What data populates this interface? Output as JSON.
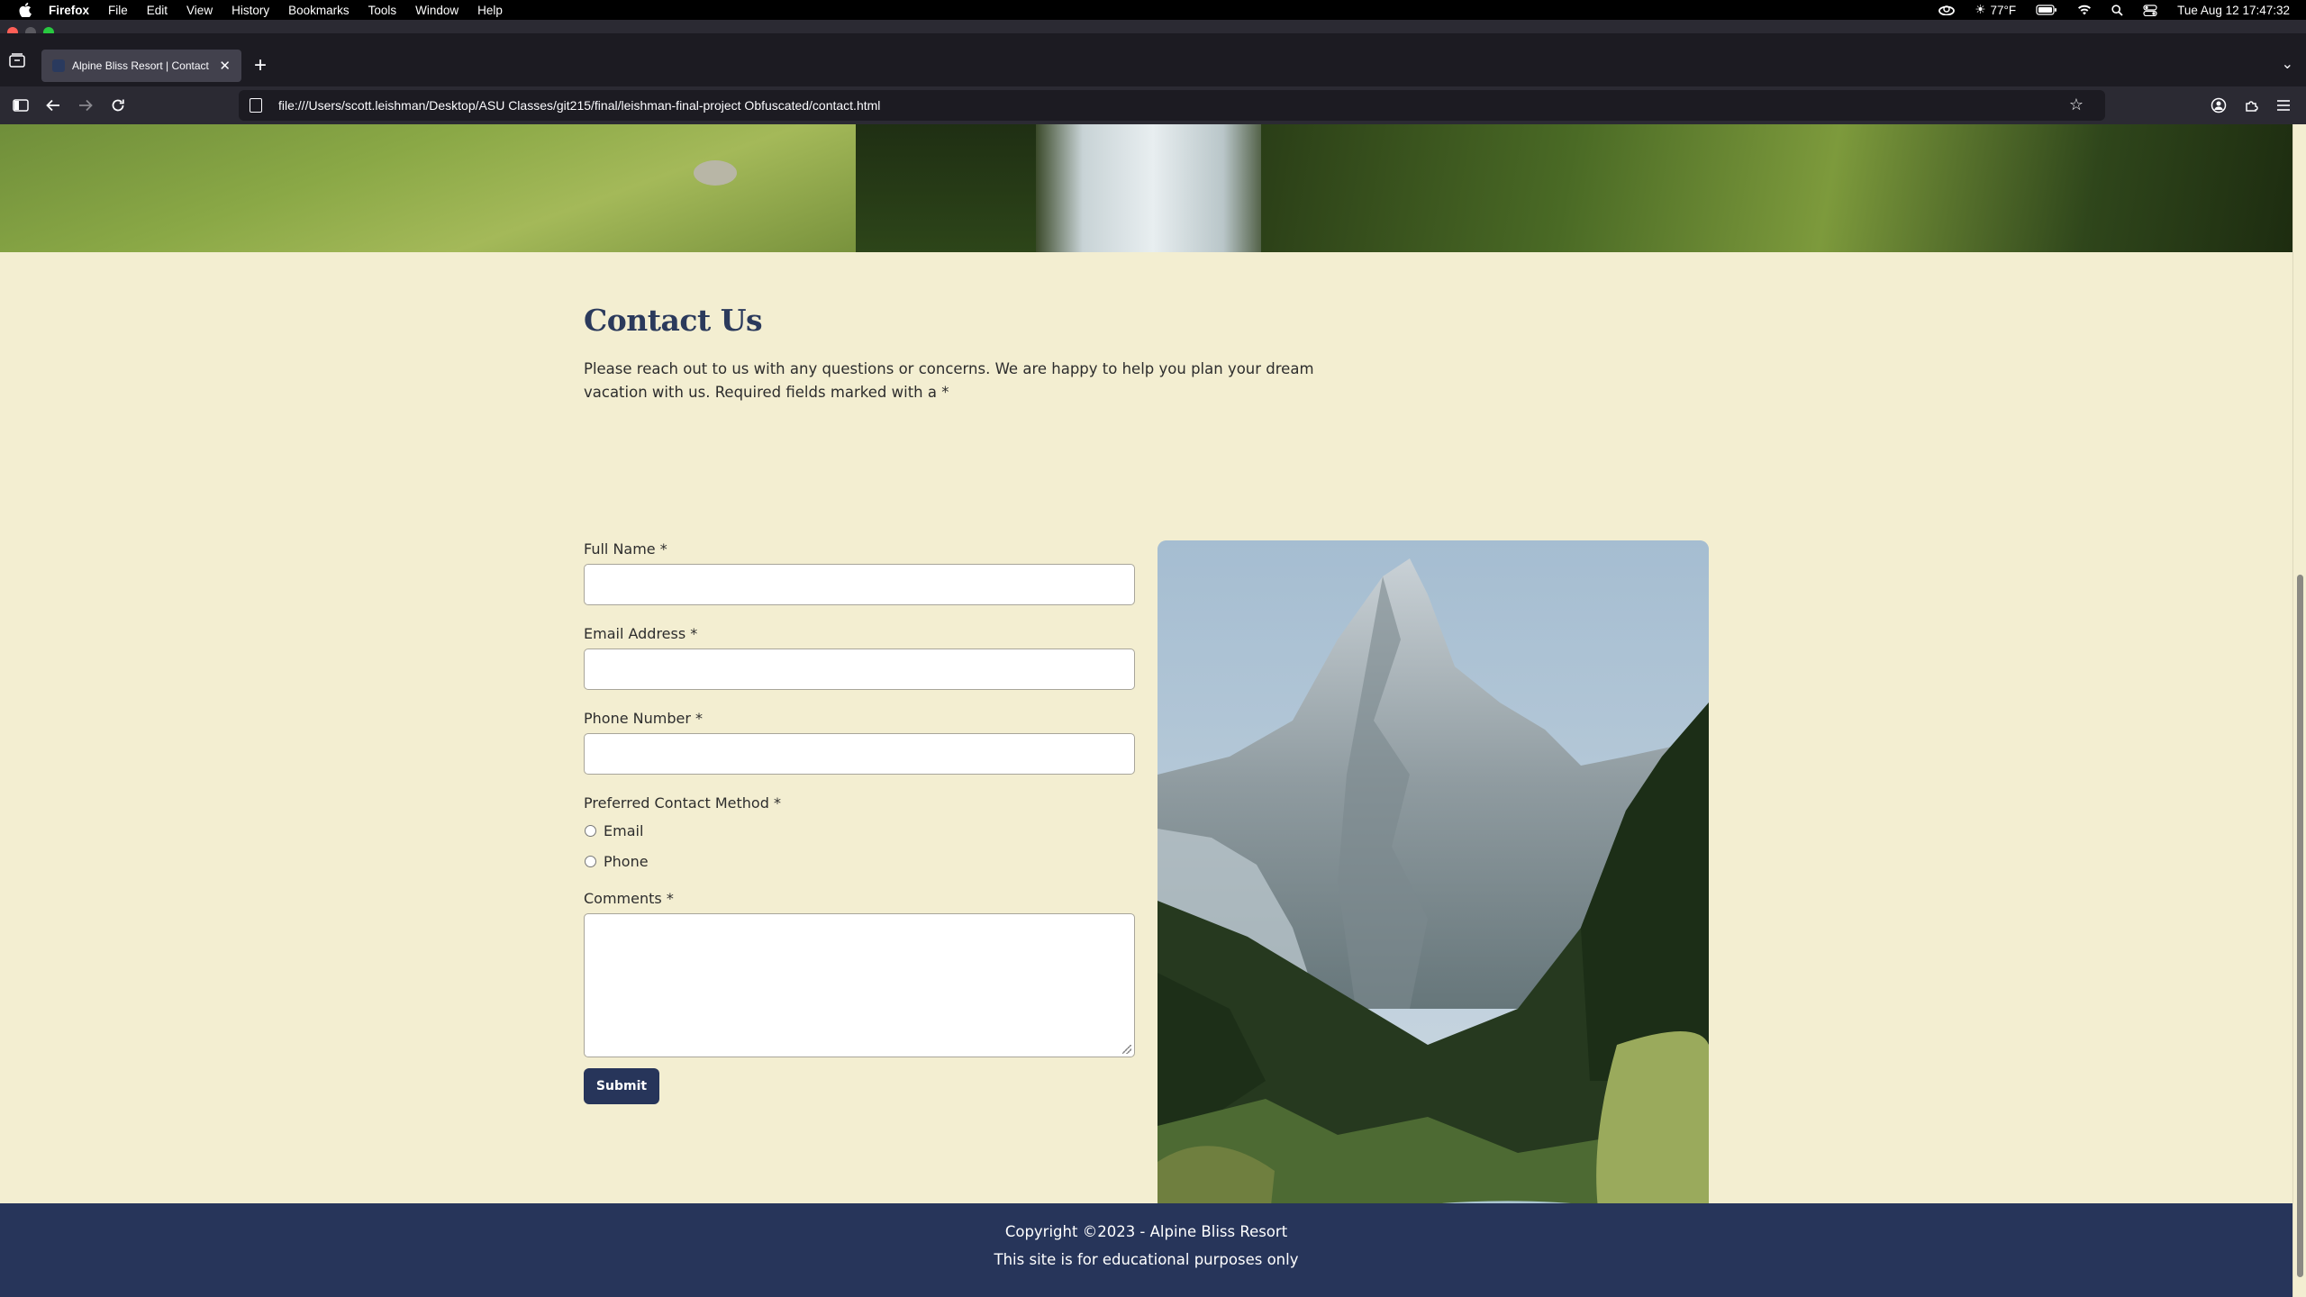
{
  "menubar": {
    "app": "Firefox",
    "items": [
      "File",
      "Edit",
      "View",
      "History",
      "Bookmarks",
      "Tools",
      "Window",
      "Help"
    ],
    "weather": "77°F",
    "datetime": "Tue Aug 12  17:47:32"
  },
  "browser": {
    "tab_title": "Alpine Bliss Resort | Contact",
    "url": "file:///Users/scott.leishman/Desktop/ASU Classes/git215/final/leishman-final-project Obfuscated/contact.html"
  },
  "page": {
    "title": "Contact Us",
    "intro": "Please reach out to us with any questions or concerns. We are happy to help you plan your dream vacation with us. Required fields marked with a *",
    "form": {
      "full_name_label": "Full Name *",
      "email_label": "Email Address *",
      "phone_label": "Phone Number *",
      "contact_method_label": "Preferred Contact Method *",
      "option_email": "Email",
      "option_phone": "Phone",
      "comments_label": "Comments *",
      "submit_label": "Submit"
    },
    "footer": {
      "copyright": "Copyright ©2023 - Alpine Bliss Resort",
      "note": "This site is for educational purposes only"
    }
  },
  "colors": {
    "page_bg": "#f3eed1",
    "navy": "#27355a",
    "heading": "#2b3a5c"
  }
}
